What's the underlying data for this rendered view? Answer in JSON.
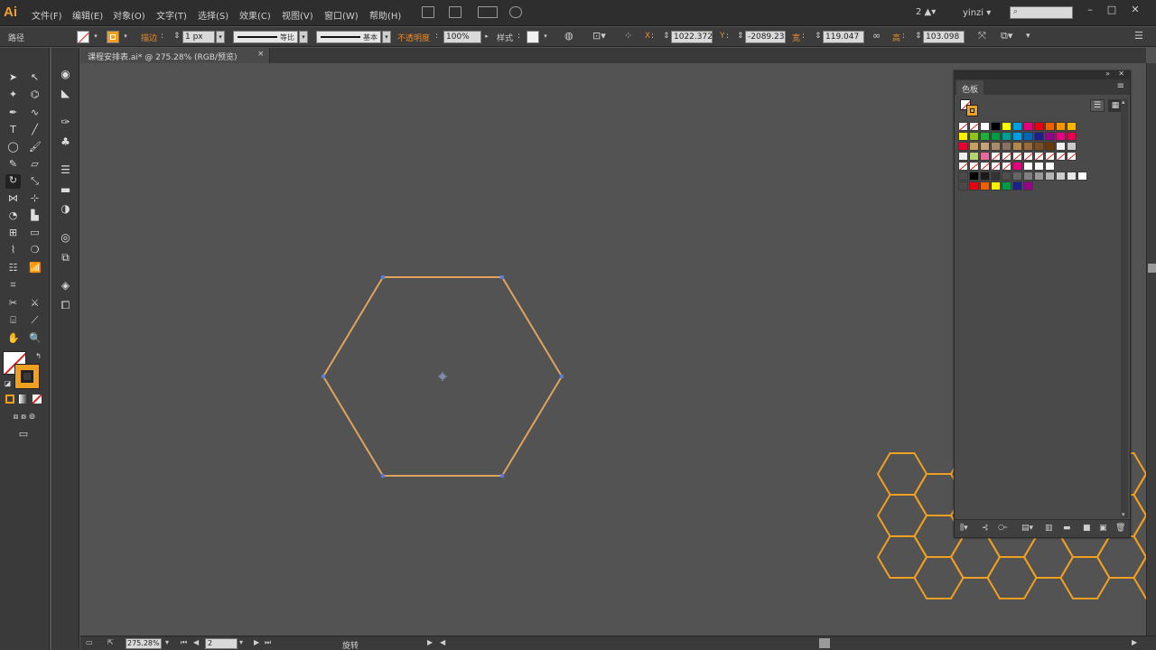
{
  "app": {
    "logo": "Ai"
  },
  "menu": [
    "文件(F)",
    "编辑(E)",
    "对象(O)",
    "文字(T)",
    "选择(S)",
    "效果(C)",
    "视图(V)",
    "窗口(W)",
    "帮助(H)"
  ],
  "menubar_right": {
    "workspace": "2",
    "user": "yinzi"
  },
  "control": {
    "selection": "路径",
    "stroke_label": "描边",
    "stroke_weight": "1 px",
    "profile": "等比",
    "brush": "基本",
    "opacity_label": "不透明度",
    "opacity": "100%",
    "style_label": "样式",
    "x_label": "X",
    "x": "1022.372",
    "y_label": "Y",
    "y": "-2089.23",
    "w_label": "宽",
    "w": "119.047",
    "h_label": "高",
    "h": "103.098"
  },
  "document": {
    "tab": "课程安排表.ai* @ 275.28% (RGB/预览)",
    "close": "×"
  },
  "status": {
    "zoom": "275.28%",
    "page": "2",
    "tool": "旋转"
  },
  "swatches": {
    "tab": "色板",
    "menu": "≡",
    "rows": [
      [
        "#ffffff",
        "#ffffff",
        "#ffffff",
        "#000000",
        "#ffff00",
        "#00a0e0",
        "#e6007e",
        "#e60012",
        "#eb6100",
        "#f39800",
        "#f8b500"
      ],
      [
        "#fff100",
        "#8fc31f",
        "#22ac38",
        "#009944",
        "#009e96",
        "#00a0e9",
        "#0068b7",
        "#1d2088",
        "#920783",
        "#e4007f",
        "#e5004f"
      ],
      [
        "#e60033",
        "#c9a063",
        "#c3a37a",
        "#a68b6d",
        "#8a7260",
        "#b28850",
        "#9a6b3a",
        "#7d4e24",
        "#6a3906",
        "#f3f3f3",
        "#c9c9c9"
      ],
      [
        "#f0f0f0",
        "#b4d474",
        "#e26b9b",
        "#ffffff",
        "#ffffff",
        "#ffffff",
        "#ffffff",
        "#ffffff",
        "#ffffff",
        "#ffffff",
        "#ffffff"
      ],
      [
        "#ffffff",
        "#ffffff",
        "#ffffff",
        "#ffffff",
        "#ffffff",
        "#e4007f",
        "#ffffff",
        "#ffffff",
        "#ffffff"
      ],
      [
        "#4a4a4a",
        "#000000",
        "#1a1a1a",
        "#333333",
        "#4d4d4d",
        "#666666",
        "#808080",
        "#999999",
        "#b3b3b3",
        "#cccccc",
        "#e6e6e6",
        "#ffffff"
      ],
      [
        "#4a4a4a",
        "#e60012",
        "#eb6100",
        "#fff100",
        "#009944",
        "#1d2088",
        "#920783"
      ]
    ],
    "accent": "#f0a020"
  },
  "colors": {
    "hex_stroke": "#e0a35e",
    "anchor": "#5b7bd9",
    "bg_hex": "#f0a020"
  }
}
